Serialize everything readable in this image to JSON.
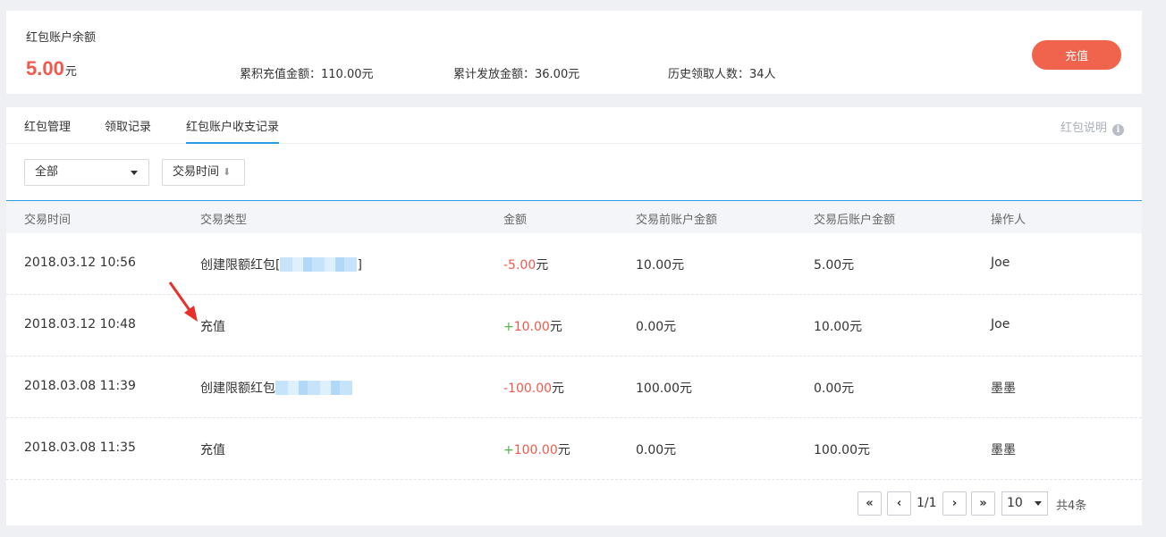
{
  "summary": {
    "balance_label": "红包账户余额",
    "balance_amount": "5.00",
    "balance_unit": "元",
    "total_recharge": "累积充值金额：110.00元",
    "total_issued": "累计发放金额：36.00元",
    "history_receivers": "历史领取人数：34人",
    "recharge_button": "充值"
  },
  "tabs": [
    {
      "label": "红包管理",
      "active": false
    },
    {
      "label": "领取记录",
      "active": false
    },
    {
      "label": "红包账户收支记录",
      "active": true
    }
  ],
  "help": {
    "label": "红包说明",
    "icon": "info-icon"
  },
  "filters": {
    "type_select": "全部",
    "sort_label": "交易时间",
    "sort_icon": "⬇"
  },
  "table": {
    "headers": [
      "交易时间",
      "交易类型",
      "金额",
      "交易前账户金额",
      "交易后账户金额",
      "操作人"
    ],
    "rows": [
      {
        "time": "2018.03.12 10:56",
        "type": "创建限额红包[",
        "type_end": "]",
        "sign": "",
        "amount": "-5.00",
        "unit": "元",
        "before": "10.00元",
        "after": "5.00元",
        "operator": "Joe"
      },
      {
        "time": "2018.03.12 10:48",
        "type": "充值",
        "type_end": "",
        "sign": "+",
        "amount": "10.00",
        "unit": "元",
        "before": "0.00元",
        "after": "10.00元",
        "operator": "Joe"
      },
      {
        "time": "2018.03.08 11:39",
        "type": "创建限额红包",
        "type_end": "",
        "sign": "",
        "amount": "-100.00",
        "unit": "元",
        "before": "100.00元",
        "after": "0.00元",
        "operator": "墨墨"
      },
      {
        "time": "2018.03.08 11:35",
        "type": "充值",
        "type_end": "",
        "sign": "+",
        "amount": "100.00",
        "unit": "元",
        "before": "0.00元",
        "after": "100.00元",
        "operator": "墨墨"
      }
    ]
  },
  "pagination": {
    "first": "«",
    "prev": "‹",
    "page_info": "1/1",
    "next": "›",
    "last": "»",
    "page_size": "10",
    "total": "共4条"
  },
  "colors": {
    "accent": "#2a9be8",
    "danger": "#f05a4a",
    "positive": "#52b54b",
    "button": "#f0634d"
  }
}
